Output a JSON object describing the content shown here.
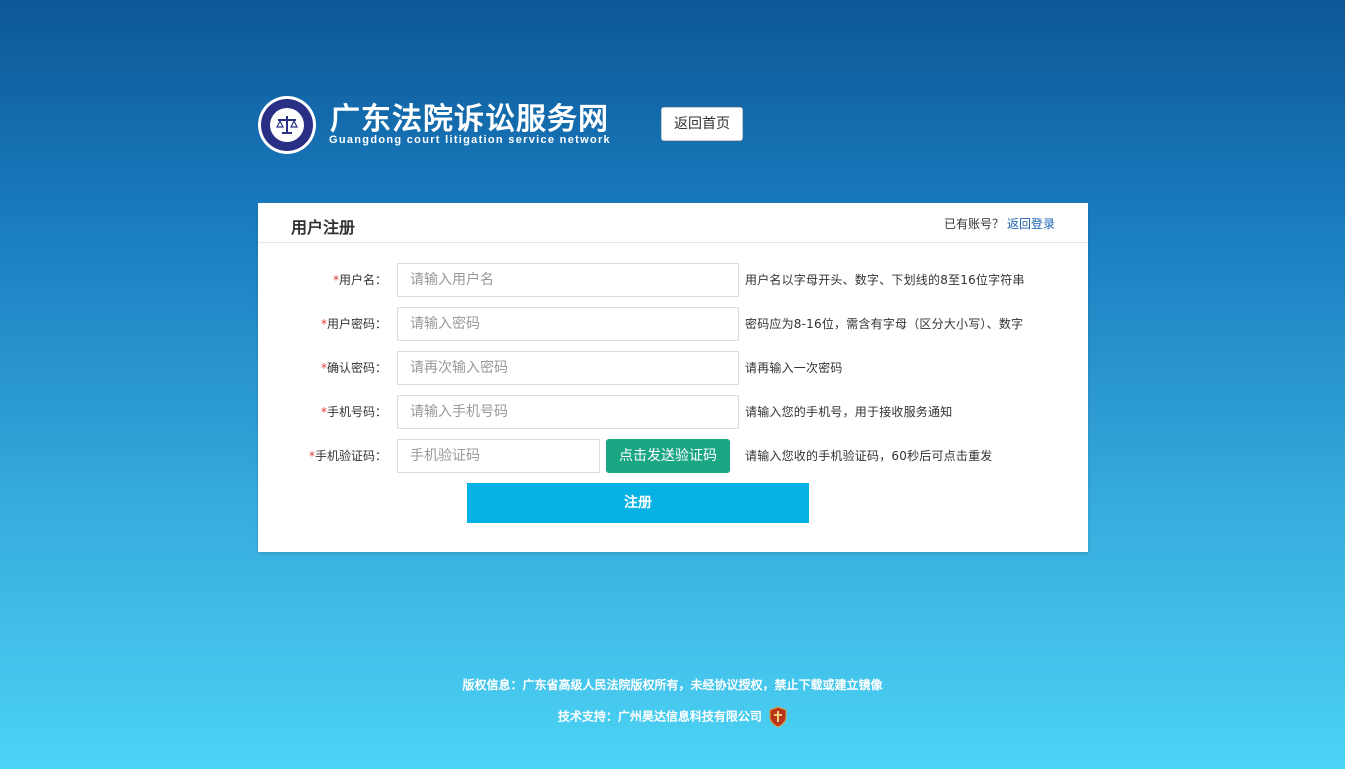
{
  "header": {
    "title": "广东法院诉讼服务网",
    "subtitle": "Guangdong court litigation service network",
    "back_home_label": "返回首页"
  },
  "panel": {
    "title": "用户注册",
    "have_account_text": "已有账号？",
    "back_login_label": "返回登录"
  },
  "form": {
    "required_mark": "*",
    "fields": [
      {
        "label": "用户名：",
        "placeholder": "请输入用户名",
        "hint": "用户名以字母开头、数字、下划线的8至16位字符串"
      },
      {
        "label": "用户密码：",
        "placeholder": "请输入密码",
        "hint": "密码应为8-16位，需含有字母（区分大小写）、数字"
      },
      {
        "label": "确认密码：",
        "placeholder": "请再次输入密码",
        "hint": "请再输入一次密码"
      },
      {
        "label": "手机号码：",
        "placeholder": "请输入手机号码",
        "hint": "请输入您的手机号，用于接收服务通知"
      },
      {
        "label": "手机验证码：",
        "placeholder": "手机验证码",
        "hint": "请输入您收的手机验证码，60秒后可点击重发"
      }
    ],
    "send_code_label": "点击发送验证码",
    "submit_label": "注册"
  },
  "footer": {
    "copyright": "版权信息：广东省高级人民法院版权所有，未经协议授权，禁止下载或建立镜像",
    "support": "技术支持：广州昊达信息科技有限公司"
  },
  "icons": {
    "emblem": "court-emblem-icon",
    "badge": "security-badge-icon"
  },
  "colors": {
    "send_code_button": "#1aa583",
    "submit_button": "#06b2e4",
    "link": "#1a63b0",
    "required": "#e4393c"
  }
}
